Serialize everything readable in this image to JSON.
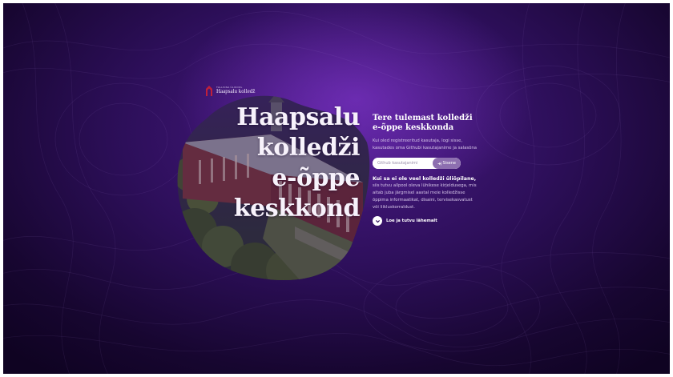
{
  "logo": {
    "small_text": "TALLINNA ÜLIKOOL",
    "name": "Haapsalu kolledž",
    "icon": "college-arch-icon",
    "accent_color": "#c0203a"
  },
  "hero": {
    "title_lines": [
      "Haapsalu",
      "kolledži",
      "e-õppe",
      "keskkond"
    ]
  },
  "welcome": {
    "title": "Tere tulemast kolledži e-õppe keskkonda",
    "description": "Kui oled registreeritud kasutaja, logi sisse, kasutades oma Githubi kasutajanime ja salasõna"
  },
  "login": {
    "placeholder": "Github kasutajanimi",
    "button_label": "Sisene",
    "button_icon": "login-arrow-icon"
  },
  "notice": {
    "title": "Kui sa ei ole veel kolledži üliõpilane,",
    "description": "siis tutvu allpool oleva lühikese kirjeldusega, mis aitab juba järgmisel aastal meie kolledžisse õppima informaatikat, disaini, tervisekasvatust või liikluskorraldust."
  },
  "read_more": {
    "label": "Loe ja tutvu lähemalt",
    "icon": "chevron-down-icon"
  },
  "colors": {
    "background_dark": "#170630",
    "background_purple": "#4a1a86",
    "button_bg": "#8d6fb0"
  }
}
